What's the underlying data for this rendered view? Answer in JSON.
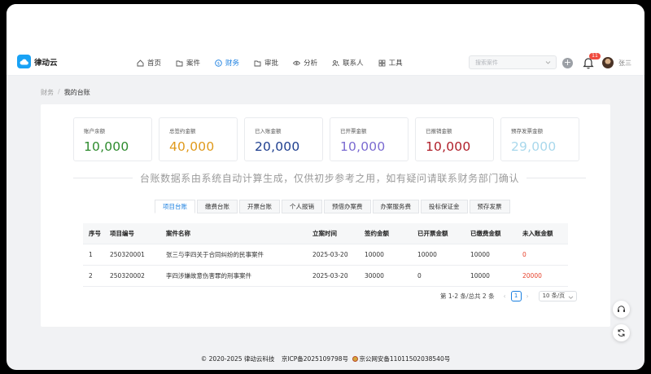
{
  "app": {
    "name": "律动云",
    "brand_color": "#19a2f5",
    "accent_color": "#1a7fe0"
  },
  "nav": {
    "items": [
      {
        "label": "首页",
        "icon": "home-icon"
      },
      {
        "label": "案件",
        "icon": "folder-icon"
      },
      {
        "label": "财务",
        "icon": "currency-icon",
        "active": true
      },
      {
        "label": "审批",
        "icon": "folder-icon"
      },
      {
        "label": "分析",
        "icon": "eye-icon"
      },
      {
        "label": "联系人",
        "icon": "contacts-icon"
      },
      {
        "label": "工具",
        "icon": "grid-icon"
      }
    ]
  },
  "search": {
    "placeholder": "搜索案件"
  },
  "notifications": {
    "count": "11"
  },
  "user": {
    "name": "张三"
  },
  "breadcrumb": {
    "parent": "财务",
    "separator": "/",
    "current": "我的台账"
  },
  "cards": [
    {
      "label": "账户余额",
      "value": "10,000",
      "color": "#2e8b2e"
    },
    {
      "label": "总签约金额",
      "value": "40,000",
      "color": "#e09a1c"
    },
    {
      "label": "已入账金额",
      "value": "20,000",
      "color": "#1f3f8f"
    },
    {
      "label": "已开票金额",
      "value": "10,000",
      "color": "#7b6bd1"
    },
    {
      "label": "已报销金额",
      "value": "10,000",
      "color": "#b0202a"
    },
    {
      "label": "预存发票金额",
      "value": "29,000",
      "color": "#a9d8ec"
    }
  ],
  "notice": "台账数据系由系统自动计算生成，仅供初步参考之用，如有疑问请联系财务部门确认",
  "tabs": [
    {
      "label": "项目台账",
      "active": true
    },
    {
      "label": "缴费台账"
    },
    {
      "label": "开票台账"
    },
    {
      "label": "个人报销"
    },
    {
      "label": "预借办案费"
    },
    {
      "label": "办案服务费"
    },
    {
      "label": "投标保证金"
    },
    {
      "label": "预存发票"
    }
  ],
  "table": {
    "headers": [
      "序号",
      "项目编号",
      "案件名称",
      "立案时间",
      "签约金额",
      "已开票金额",
      "已缴费金额",
      "未入账金额"
    ],
    "rows": [
      [
        "1",
        "250320001",
        "张三与李四关于合同纠纷的民事案件",
        "2025-03-20",
        "10000",
        "10000",
        "10000",
        "0"
      ],
      [
        "2",
        "250320002",
        "李四涉嫌故意伤害罪的刑事案件",
        "2025-03-20",
        "30000",
        "0",
        "10000",
        "20000"
      ]
    ]
  },
  "pagination": {
    "summary": "第 1-2 条/总共 2 条",
    "current_page": "1",
    "page_size": "10 条/页"
  },
  "footer": {
    "copyright": "© 2020-2025 律动云科技",
    "icp": "京ICP备2025109798号",
    "police": "京公网安备11011502038540号"
  }
}
